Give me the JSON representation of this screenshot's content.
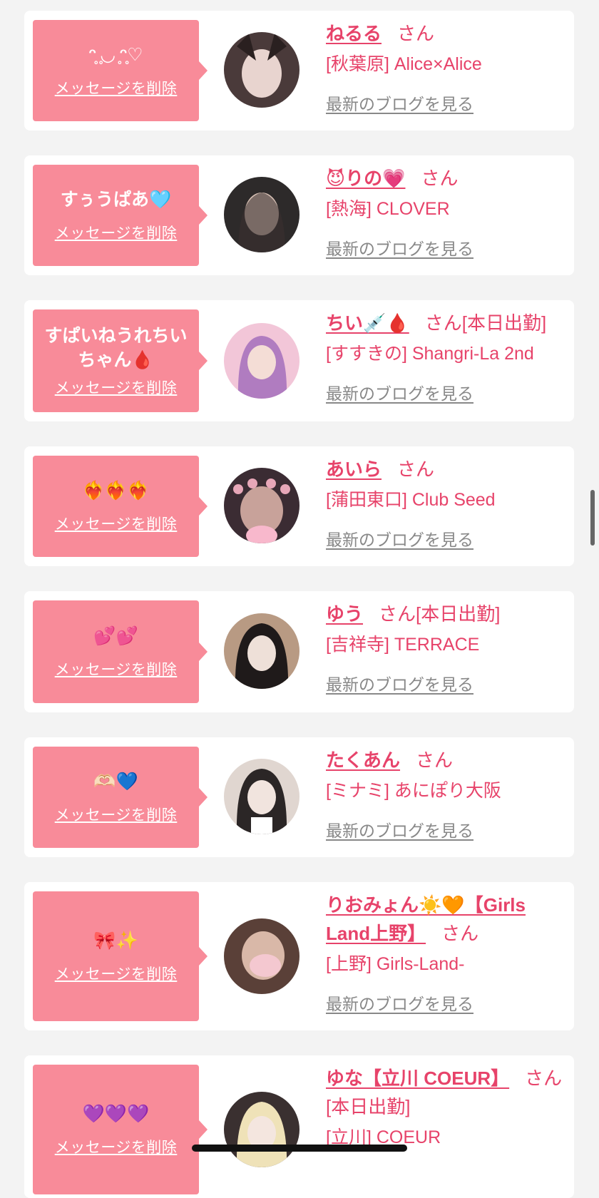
{
  "delete_label": "メッセージを削除",
  "san_label": "さん",
  "blog_label": "最新のブログを見る",
  "accent_color": "#e7436a",
  "message_bg_color": "#f88b99",
  "cards": [
    {
      "message": "ᵔ̥ ̥◡ ̥ᵔ̥♡",
      "name": "ねるる",
      "badge": "",
      "shop": "[秋葉原] Alice×Alice",
      "avatar_colors": [
        "#4a3a3a",
        "#c9b3b3"
      ]
    },
    {
      "message": "すぅうぱあ🩵",
      "name": "😈りの💗",
      "badge": "",
      "shop": "[熱海] CLOVER",
      "avatar_colors": [
        "#2d2a2a",
        "#a08c82"
      ]
    },
    {
      "message": "すぱいねうれちいちゃん🩸",
      "name": "ちい💉🩸",
      "badge": "[本日出勤]",
      "shop": "[すすきの] Shangri-La 2nd",
      "avatar_colors": [
        "#b07cc0",
        "#f2c6d8"
      ]
    },
    {
      "message": "❤️‍🔥❤️‍🔥❤️‍🔥",
      "name": "あいら",
      "badge": "",
      "shop": "[蒲田東口] Club Seed",
      "avatar_colors": [
        "#3b2c33",
        "#e7a7b8"
      ]
    },
    {
      "message": "💕💕",
      "name": "ゆう",
      "badge": "[本日出勤]",
      "shop": "[吉祥寺] TERRACE",
      "avatar_colors": [
        "#1f1a1a",
        "#b89a83"
      ]
    },
    {
      "message": "🫶🏻💙",
      "name": "たくあん",
      "badge": "",
      "shop": "[ミナミ] あにぽり大阪",
      "avatar_colors": [
        "#2b2626",
        "#e0d6d0"
      ]
    },
    {
      "message": "🎀✨",
      "name": "りおみょん☀️🧡【Girls Land上野】",
      "badge": "",
      "shop": "[上野] Girls-Land-",
      "avatar_colors": [
        "#5a4038",
        "#f4c8d0"
      ]
    },
    {
      "message": "💜💜💜",
      "name": "ゆな【立川 COEUR】",
      "badge": "[本日出勤]",
      "shop": "[立川] COEUR",
      "avatar_colors": [
        "#3a3030",
        "#efe2b8"
      ]
    }
  ]
}
